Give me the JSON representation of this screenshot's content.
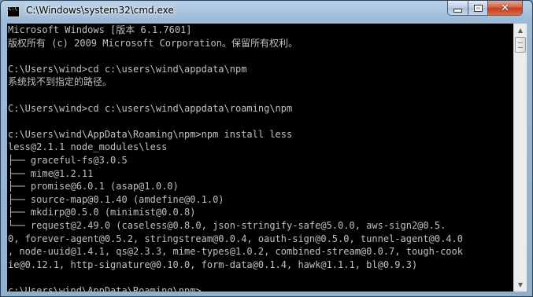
{
  "window": {
    "title": "C:\\Windows\\system32\\cmd.exe",
    "icon": "cmd-console-icon",
    "controls": {
      "minimize": "minimize-icon",
      "maximize": "maximize-icon",
      "close": "close-icon"
    }
  },
  "console": {
    "lines": [
      "Microsoft Windows [版本 6.1.7601]",
      "版权所有 (c) 2009 Microsoft Corporation。保留所有权利。",
      "",
      "C:\\Users\\wind>cd c:\\users\\wind\\appdata\\npm",
      "系统找不到指定的路径。",
      "",
      "C:\\Users\\wind>cd c:\\users\\wind\\appdata\\roaming\\npm",
      "",
      "c:\\Users\\wind\\AppData\\Roaming\\npm>npm install less",
      "less@2.1.1 node_modules\\less",
      "├── graceful-fs@3.0.5",
      "├── mime@1.2.11",
      "├── promise@6.0.1 (asap@1.0.0)",
      "├── source-map@0.1.40 (amdefine@0.1.0)",
      "├── mkdirp@0.5.0 (minimist@0.0.8)",
      "└── request@2.49.0 (caseless@0.8.0, json-stringify-safe@5.0.0, aws-sign2@0.5.",
      "0, forever-agent@0.5.2, stringstream@0.0.4, oauth-sign@0.5.0, tunnel-agent@0.4.0",
      ", node-uuid@1.4.1, qs@2.3.3, mime-types@1.0.2, combined-stream@0.0.7, tough-cook",
      "ie@0.12.1, http-signature@0.10.0, form-data@0.1.4, hawk@1.1.1, bl@0.9.3)",
      "",
      "c:\\Users\\wind\\AppData\\Roaming\\npm>"
    ]
  },
  "colors": {
    "console_background": "#000000",
    "console_text": "#c0c0c0",
    "close_button": "#c43b1e"
  }
}
